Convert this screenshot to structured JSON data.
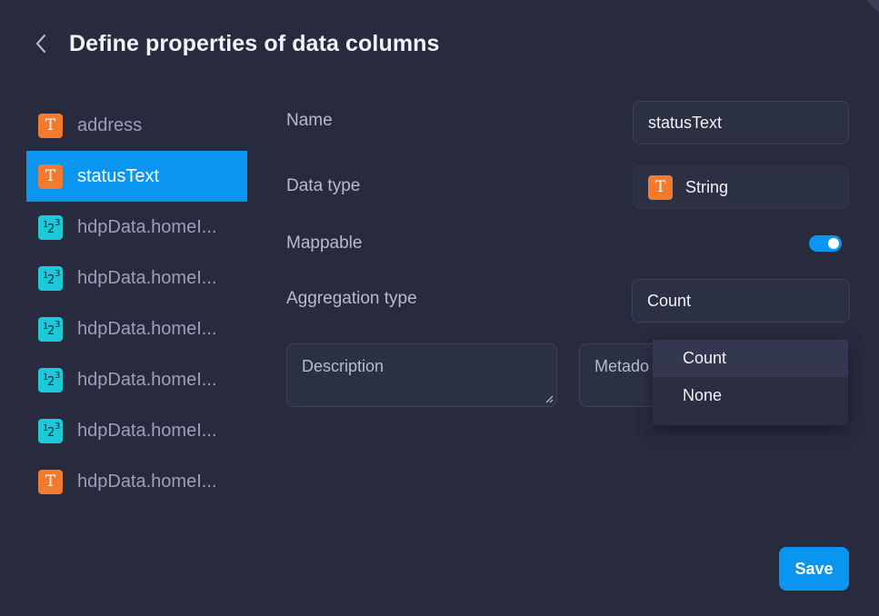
{
  "header": {
    "title": "Define properties of data columns",
    "back_icon": "chevron-left-icon"
  },
  "columns": [
    {
      "label": "address",
      "type": "text",
      "glyph": "T"
    },
    {
      "label": "statusText",
      "type": "text",
      "glyph": "T",
      "selected": true
    },
    {
      "label": "hdpData.homeI...",
      "type": "number",
      "glyph": "123"
    },
    {
      "label": "hdpData.homeI...",
      "type": "number",
      "glyph": "123"
    },
    {
      "label": "hdpData.homeI...",
      "type": "number",
      "glyph": "123"
    },
    {
      "label": "hdpData.homeI...",
      "type": "number",
      "glyph": "123"
    },
    {
      "label": "hdpData.homeI...",
      "type": "number",
      "glyph": "123"
    },
    {
      "label": "hdpData.homeI...",
      "type": "text",
      "glyph": "T"
    }
  ],
  "glyphs": {
    "text": "T",
    "num_1": "1",
    "num_2": "2",
    "num_3": "3"
  },
  "form": {
    "name_label": "Name",
    "name_value": "statusText",
    "data_type_label": "Data type",
    "data_type_value": "String",
    "mappable_label": "Mappable",
    "mappable_on": true,
    "aggregation_label": "Aggregation type",
    "aggregation_value": "Count",
    "description_placeholder": "Description",
    "metadata_placeholder": "Metado"
  },
  "aggregation_dropdown": {
    "options": [
      "Count",
      "None"
    ],
    "highlighted": "Count"
  },
  "actions": {
    "save_label": "Save"
  },
  "colors": {
    "background": "#272b3d",
    "accent": "#0a96f0",
    "text_type": "#f47a2e",
    "number_type": "#1ec8d8"
  }
}
